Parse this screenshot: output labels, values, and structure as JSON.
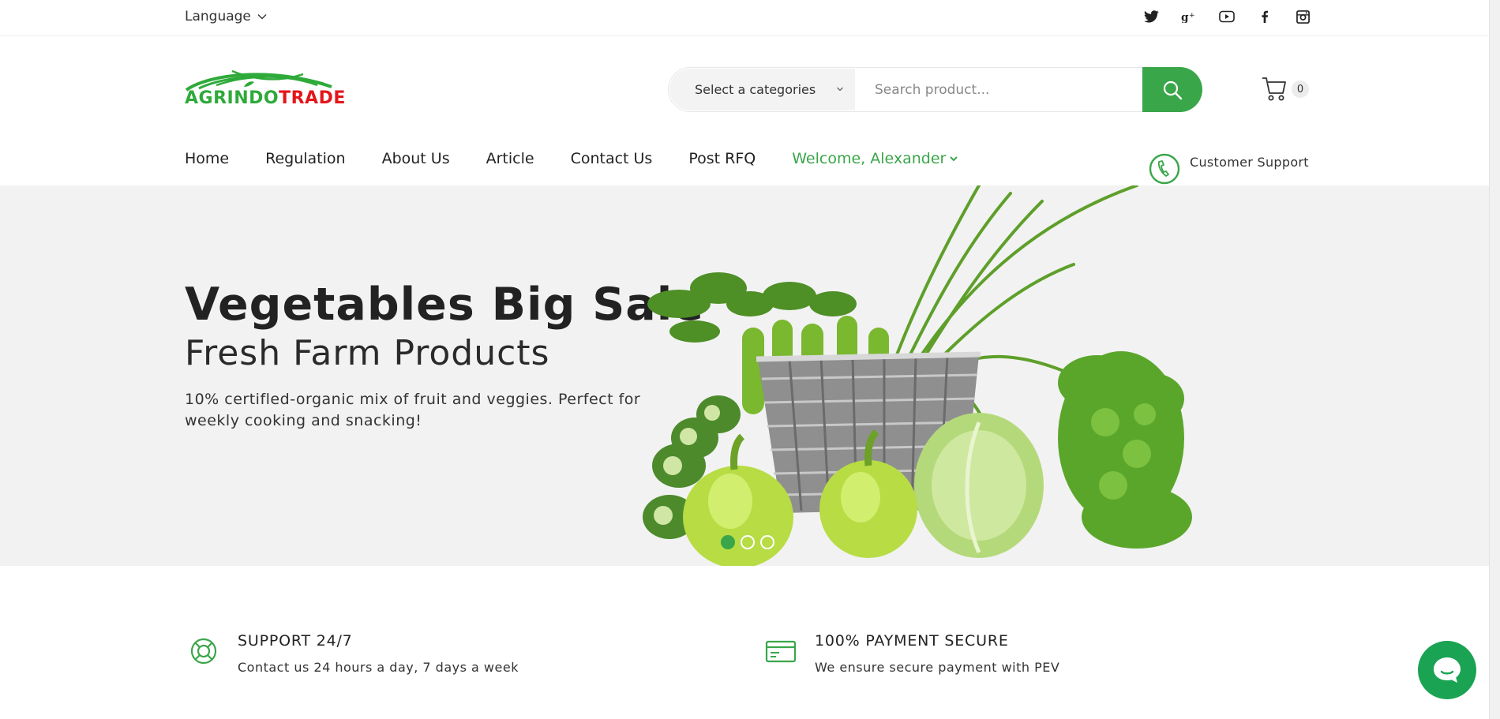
{
  "topbar": {
    "language_label": "Language",
    "social_icons": [
      "twitter-icon",
      "google-plus-icon",
      "youtube-icon",
      "facebook-icon",
      "instagram-icon"
    ]
  },
  "header": {
    "logo": {
      "part1": "AGRINDO",
      "part2": "TRADE"
    },
    "category_select": "Select a categories",
    "search_placeholder": "Search product...",
    "cart_count": "0"
  },
  "nav": {
    "items": [
      "Home",
      "Regulation",
      "About Us",
      "Article",
      "Contact Us",
      "Post RFQ"
    ],
    "welcome": "Welcome, Alexander",
    "support_label": "Customer Support"
  },
  "hero": {
    "title": "Vegetables Big Sale",
    "subtitle": "Fresh Farm Products",
    "description": "10% certifled-organic mix of fruit and veggies. Perfect for weekly cooking and snacking!",
    "slide_count": 3,
    "active_slide": 1
  },
  "features": [
    {
      "title": "SUPPORT 24/7",
      "text": "Contact us 24 hours a day, 7 days a week",
      "icon": "lifebuoy-icon"
    },
    {
      "title": "100% PAYMENT SECURE",
      "text": "We ensure secure payment with PEV",
      "icon": "credit-card-icon"
    }
  ],
  "colors": {
    "accent": "#3aa64a",
    "logo_red": "#e3161b",
    "hero_bg": "#f2f2f2",
    "chat": "#1aa352"
  }
}
